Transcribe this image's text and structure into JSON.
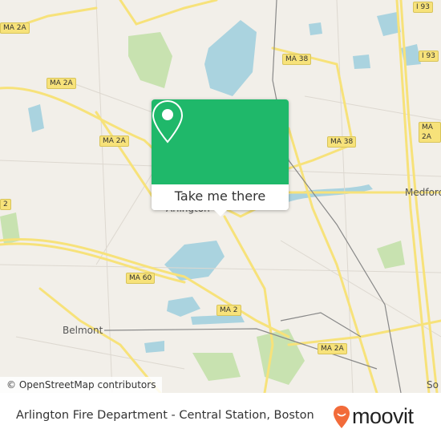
{
  "map": {
    "places": [
      "Arlington",
      "Belmont",
      "Medford",
      "So"
    ],
    "shields": [
      "MA 2A",
      "MA 2A",
      "MA 2A",
      "MA 2A",
      "MA 38",
      "MA 38",
      "MA 60",
      "MA 2",
      "I 93",
      "I 93",
      "2",
      "MA 2A"
    ],
    "attribution": "© OpenStreetMap contributors",
    "colors": {
      "land": "#f2efe9",
      "water": "#aad3df",
      "park": "#c8e2b0",
      "road": "#f7e27a"
    }
  },
  "popup": {
    "icon": "map-pin-icon",
    "button_label": "Take me there",
    "color": "#1fb86a"
  },
  "footer": {
    "title": "Arlington Fire Department - Central Station, Boston",
    "logo_text": "moovit",
    "logo_color": "#f26b3a"
  }
}
